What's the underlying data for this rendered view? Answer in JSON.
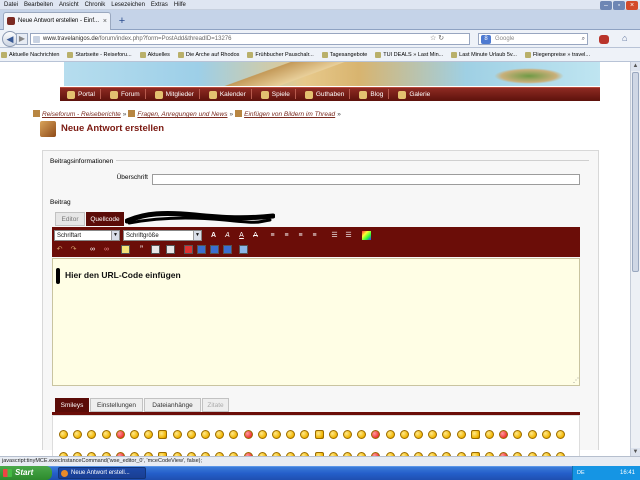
{
  "browser": {
    "menu": [
      "Datei",
      "Bearbeiten",
      "Ansicht",
      "Chronik",
      "Lesezeichen",
      "Extras",
      "Hilfe"
    ],
    "tab_title": "Neue Antwort erstellen - Einf...",
    "url_host": "www.travelanigos.de",
    "url_path": "/forum/index.php?form=PostAdd&threadID=13276",
    "search_placeholder": "Google",
    "bookmarks": [
      "Aktuelle Nachrichten",
      "Startseite - Reiseforu...",
      "Aktuelles",
      "Die Arche auf Rhodos",
      "Frühbucher Pauschalr...",
      "Tagesangebote",
      "TUI DEALS » Last Min...",
      "Last Minute Urlaub 5v...",
      "Fliegenpreise » travel..."
    ]
  },
  "site": {
    "nav": [
      "Portal",
      "Forum",
      "Mitglieder",
      "Kalender",
      "Spiele",
      "Guthaben",
      "Blog",
      "Galerie"
    ],
    "breadcrumb": [
      "Reiseforum - Reiseberichte",
      "Fragen, Anregungen und News",
      "Einfügen von Bildern im Thread"
    ],
    "page_title": "Neue Antwort erstellen"
  },
  "form": {
    "section1_legend": "Beitragsinformationen",
    "subject_label": "Überschrift",
    "subject_value": "",
    "section2_legend": "Beitrag",
    "tabs": [
      "Editor",
      "Quellcode"
    ],
    "font_select": "Schriftart",
    "size_select": "Schriftgröße",
    "editor_text": "Hier den URL-Code einfügen",
    "bottom_tabs": [
      "Smileys",
      "Einstellungen",
      "Dateianhänge",
      "Zitate"
    ]
  },
  "status_text": "javascript:tinyMCE.execInstanceCommand('wse_editor_0', 'mceCodeView', false);",
  "taskbar": {
    "start": "Start",
    "item": "Neue Antwort erstell...",
    "lang": "DE",
    "time": "16:41"
  },
  "colors": {
    "accent": "#6b0d08",
    "nav": "#7b1a12",
    "editor_bg": "#fffee5"
  }
}
